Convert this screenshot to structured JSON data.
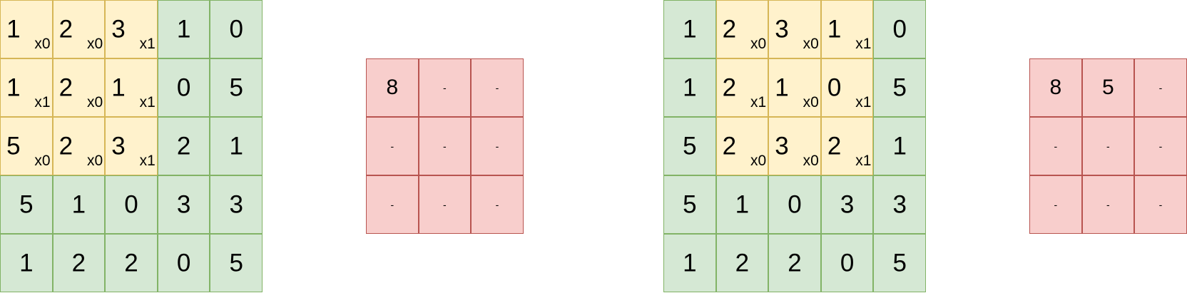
{
  "colors": {
    "input_cell": "#d5e8d4",
    "input_border": "#82b366",
    "kernel_cell": "#fff2cc",
    "kernel_border": "#d6b656",
    "output_cell": "#f8cecc",
    "output_border": "#b85450"
  },
  "panels": [
    {
      "input": [
        [
          "1",
          "2",
          "3",
          "1",
          "0"
        ],
        [
          "1",
          "2",
          "1",
          "0",
          "5"
        ],
        [
          "5",
          "2",
          "3",
          "2",
          "1"
        ],
        [
          "5",
          "1",
          "0",
          "3",
          "3"
        ],
        [
          "1",
          "2",
          "2",
          "0",
          "5"
        ]
      ],
      "kernel_position": {
        "row": 0,
        "col": 0
      },
      "kernel": [
        [
          "x0",
          "x0",
          "x1"
        ],
        [
          "x1",
          "x0",
          "x1"
        ],
        [
          "x0",
          "x0",
          "x1"
        ]
      ],
      "output": [
        [
          "8",
          "-",
          "-"
        ],
        [
          "-",
          "-",
          "-"
        ],
        [
          "-",
          "-",
          "-"
        ]
      ]
    },
    {
      "input": [
        [
          "1",
          "2",
          "3",
          "1",
          "0"
        ],
        [
          "1",
          "2",
          "1",
          "0",
          "5"
        ],
        [
          "5",
          "2",
          "3",
          "2",
          "1"
        ],
        [
          "5",
          "1",
          "0",
          "3",
          "3"
        ],
        [
          "1",
          "2",
          "2",
          "0",
          "5"
        ]
      ],
      "kernel_position": {
        "row": 0,
        "col": 1
      },
      "kernel": [
        [
          "x0",
          "x0",
          "x1"
        ],
        [
          "x1",
          "x0",
          "x1"
        ],
        [
          "x0",
          "x0",
          "x1"
        ]
      ],
      "output": [
        [
          "8",
          "5",
          "-"
        ],
        [
          "-",
          "-",
          "-"
        ],
        [
          "-",
          "-",
          "-"
        ]
      ]
    }
  ]
}
